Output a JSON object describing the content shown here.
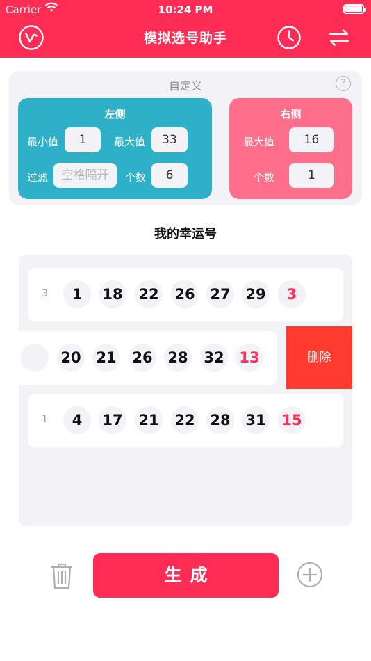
{
  "status_bar": {
    "carrier": "Carrier",
    "time": "10:24 PM"
  },
  "nav": {
    "title": "模拟选号助手",
    "left_icon": "v-logo-icon",
    "history_icon": "clock-icon",
    "swap_icon": "swap-arrows-icon"
  },
  "settings": {
    "title": "自定义",
    "help_label": "?",
    "left": {
      "title": "左侧",
      "min_label": "最小值",
      "min_value": "1",
      "max_label": "最大值",
      "max_value": "33",
      "filter_label": "过滤",
      "filter_placeholder": "空格隔开",
      "count_label": "个数",
      "count_value": "6"
    },
    "right": {
      "title": "右侧",
      "max_label": "最大值",
      "max_value": "16",
      "count_label": "个数",
      "count_value": "1"
    }
  },
  "lucky_title": "我的幸运号",
  "results": {
    "rows": [
      {
        "index": "3",
        "numbers": [
          "1",
          "18",
          "22",
          "26",
          "27",
          "29"
        ],
        "special": "3"
      },
      {
        "index": "",
        "numbers": [
          "20",
          "21",
          "26",
          "28",
          "32"
        ],
        "special": "13"
      },
      {
        "index": "1",
        "numbers": [
          "4",
          "17",
          "21",
          "22",
          "28",
          "31"
        ],
        "special": "15"
      }
    ],
    "delete_label": "删除"
  },
  "bottom": {
    "generate_label": "生成",
    "trash_icon": "trash-icon",
    "add_icon": "plus-circle-icon"
  },
  "colors": {
    "brand": "#ff2d55",
    "left_panel": "#2fb0c9",
    "right_panel": "#ff6f8b",
    "delete": "#ff3b30"
  }
}
